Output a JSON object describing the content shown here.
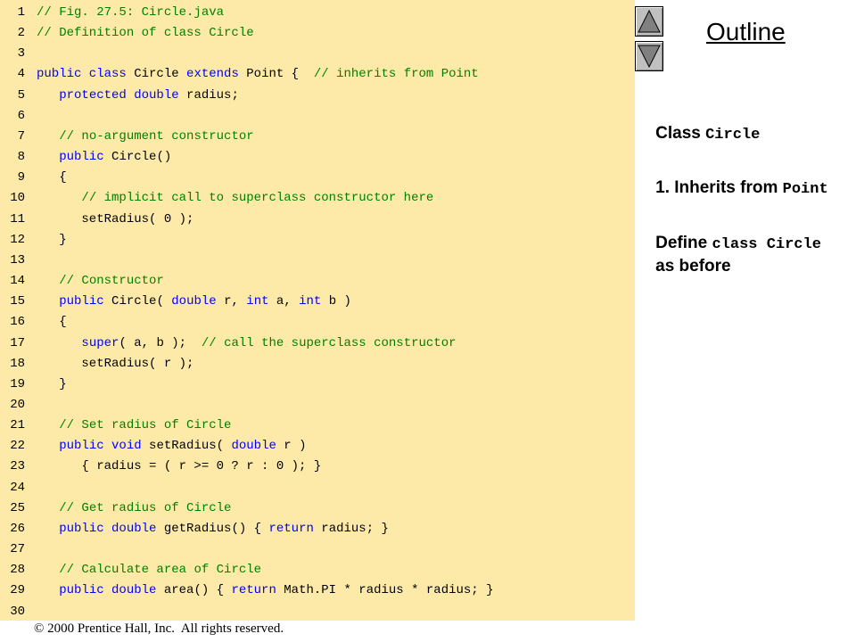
{
  "outline": {
    "title": "Outline",
    "nav_up_icon": "triangle-up-icon",
    "nav_down_icon": "triangle-down-icon",
    "items": [
      [
        {
          "t": "Class ",
          "mono": false
        },
        {
          "t": "Circle",
          "mono": true
        }
      ],
      [
        {
          "t": "1. Inherits from ",
          "mono": false
        },
        {
          "t": "Point",
          "mono": true
        }
      ],
      [
        {
          "t": "Define ",
          "mono": false
        },
        {
          "t": "class Circle",
          "mono": true
        }
      ],
      [
        {
          "t": "as before",
          "mono": false
        }
      ]
    ]
  },
  "footer": {
    "copyright_symbol": "©",
    "text": " 2000 Prentice Hall, Inc.  All rights reserved."
  },
  "colors": {
    "code_background": "#fdeaa8",
    "keyword": "#0000ff",
    "comment": "#008000",
    "text": "#000000"
  },
  "code": {
    "lines": [
      {
        "no": "1",
        "tokens": [
          [
            "cm",
            "// Fig. 27.5: Circle.java"
          ]
        ]
      },
      {
        "no": "2",
        "tokens": [
          [
            "cm",
            "// Definition of class Circle"
          ]
        ]
      },
      {
        "no": "3",
        "tokens": []
      },
      {
        "no": "4",
        "tokens": [
          [
            "kw",
            "public class"
          ],
          [
            "tx",
            " Circle "
          ],
          [
            "kw",
            "extends"
          ],
          [
            "tx",
            " Point {  "
          ],
          [
            "cm",
            "// inherits from Point"
          ]
        ]
      },
      {
        "no": "5",
        "tokens": [
          [
            "tx",
            "   "
          ],
          [
            "kw",
            "protected double"
          ],
          [
            "tx",
            " radius;"
          ]
        ]
      },
      {
        "no": "6",
        "tokens": []
      },
      {
        "no": "7",
        "tokens": [
          [
            "tx",
            "   "
          ],
          [
            "cm",
            "// no-argument constructor"
          ]
        ]
      },
      {
        "no": "8",
        "tokens": [
          [
            "tx",
            "   "
          ],
          [
            "kw",
            "public"
          ],
          [
            "tx",
            " Circle()"
          ]
        ]
      },
      {
        "no": "9",
        "tokens": [
          [
            "tx",
            "   {"
          ]
        ]
      },
      {
        "no": "10",
        "tokens": [
          [
            "tx",
            "      "
          ],
          [
            "cm",
            "// implicit call to superclass constructor here"
          ]
        ]
      },
      {
        "no": "11",
        "tokens": [
          [
            "tx",
            "      setRadius( 0 );"
          ]
        ]
      },
      {
        "no": "12",
        "tokens": [
          [
            "tx",
            "   }"
          ]
        ]
      },
      {
        "no": "13",
        "tokens": []
      },
      {
        "no": "14",
        "tokens": [
          [
            "tx",
            "   "
          ],
          [
            "cm",
            "// Constructor"
          ]
        ]
      },
      {
        "no": "15",
        "tokens": [
          [
            "tx",
            "   "
          ],
          [
            "kw",
            "public"
          ],
          [
            "tx",
            " Circle( "
          ],
          [
            "kw",
            "double"
          ],
          [
            "tx",
            " r, "
          ],
          [
            "kw",
            "int"
          ],
          [
            "tx",
            " a, "
          ],
          [
            "kw",
            "int"
          ],
          [
            "tx",
            " b )"
          ]
        ]
      },
      {
        "no": "16",
        "tokens": [
          [
            "tx",
            "   {"
          ]
        ]
      },
      {
        "no": "17",
        "tokens": [
          [
            "tx",
            "      "
          ],
          [
            "kw",
            "super"
          ],
          [
            "tx",
            "( a, b );  "
          ],
          [
            "cm",
            "// call the superclass constructor"
          ]
        ]
      },
      {
        "no": "18",
        "tokens": [
          [
            "tx",
            "      setRadius( r );"
          ]
        ]
      },
      {
        "no": "19",
        "tokens": [
          [
            "tx",
            "   }"
          ]
        ]
      },
      {
        "no": "20",
        "tokens": []
      },
      {
        "no": "21",
        "tokens": [
          [
            "tx",
            "   "
          ],
          [
            "cm",
            "// Set radius of Circle"
          ]
        ]
      },
      {
        "no": "22",
        "tokens": [
          [
            "tx",
            "   "
          ],
          [
            "kw",
            "public void"
          ],
          [
            "tx",
            " setRadius( "
          ],
          [
            "kw",
            "double"
          ],
          [
            "tx",
            " r )"
          ]
        ]
      },
      {
        "no": "23",
        "tokens": [
          [
            "tx",
            "      { radius = ( r >= 0 ? r : 0 ); }"
          ]
        ]
      },
      {
        "no": "24",
        "tokens": []
      },
      {
        "no": "25",
        "tokens": [
          [
            "tx",
            "   "
          ],
          [
            "cm",
            "// Get radius of Circle"
          ]
        ]
      },
      {
        "no": "26",
        "tokens": [
          [
            "tx",
            "   "
          ],
          [
            "kw",
            "public double"
          ],
          [
            "tx",
            " getRadius() { "
          ],
          [
            "kw",
            "return"
          ],
          [
            "tx",
            " radius; }"
          ]
        ]
      },
      {
        "no": "27",
        "tokens": []
      },
      {
        "no": "28",
        "tokens": [
          [
            "tx",
            "   "
          ],
          [
            "cm",
            "// Calculate area of Circle"
          ]
        ]
      },
      {
        "no": "29",
        "tokens": [
          [
            "tx",
            "   "
          ],
          [
            "kw",
            "public double"
          ],
          [
            "tx",
            " area() { "
          ],
          [
            "kw",
            "return"
          ],
          [
            "tx",
            " Math.PI * radius * radius; }"
          ]
        ]
      },
      {
        "no": "30",
        "tokens": []
      }
    ]
  }
}
